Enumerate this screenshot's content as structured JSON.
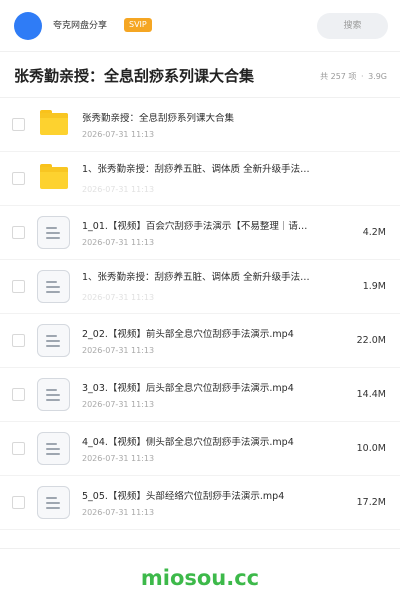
{
  "header": {
    "share_title": "夸克网盘分享",
    "svip_badge": "SVIP",
    "search_placeholder": "搜索"
  },
  "page": {
    "title": "张秀勤亲授：全息刮痧系列课大合集",
    "count": "共 257 项",
    "separator": "·",
    "total_size": "3.9G"
  },
  "files": [
    {
      "type": "folder",
      "name": "张秀勤亲授：全息刮痧系列课大合集",
      "date": "2026-07-31 11:13",
      "size": ""
    },
    {
      "type": "folder",
      "name": "1、张秀勤亲授：刮痧养五脏、调体质 全新升级手法…",
      "date": "2026-07-31 11:13",
      "size": ""
    },
    {
      "type": "file",
      "name": "1_01.【视频】百会穴刮痧手法演示【不易整理｜请…",
      "date": "2026-07-31 11:13",
      "size": "4.2M"
    },
    {
      "type": "file",
      "name": "1、张秀勤亲授：刮痧养五脏、调体质 全新升级手法…",
      "date": "2026-07-31 11:13",
      "size": "1.9M"
    },
    {
      "type": "file",
      "name": "2_02.【视频】前头部全息穴位刮痧手法演示.mp4",
      "date": "2026-07-31 11:13",
      "size": "22.0M"
    },
    {
      "type": "file",
      "name": "3_03.【视频】后头部全息穴位刮痧手法演示.mp4",
      "date": "2026-07-31 11:13",
      "size": "14.4M"
    },
    {
      "type": "file",
      "name": "4_04.【视频】侧头部全息穴位刮痧手法演示.mp4",
      "date": "2026-07-31 11:13",
      "size": "10.0M"
    },
    {
      "type": "file",
      "name": "5_05.【视频】头部经络穴位刮痧手法演示.mp4",
      "date": "2026-07-31 11:13",
      "size": "17.2M"
    }
  ],
  "footer": {
    "watermark": "miosou.cc"
  },
  "colors": {
    "avatar": "#2f7cf6",
    "svip": "#f5a623",
    "folder": "#fdd22f",
    "watermark": "#3db94a"
  }
}
